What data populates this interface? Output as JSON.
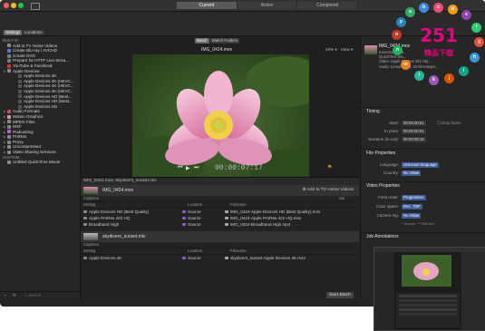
{
  "topbar": {
    "segments": [
      "Current",
      "Active",
      "Completed"
    ],
    "active_segment": 0
  },
  "sidebar": {
    "tabs": [
      "Settings",
      "Locations"
    ],
    "items": [
      {
        "label": "BUILT-IN",
        "type": "header"
      },
      {
        "label": "Add to TV Home Videos",
        "type": "item",
        "color": "#8a8a8a"
      },
      {
        "label": "Create Blu-ray / AVCHD",
        "type": "item",
        "color": "#4a7fd1"
      },
      {
        "label": "Create DVD",
        "type": "item",
        "color": "#7a7a7a"
      },
      {
        "label": "Prepare for HTTP Live Strea...",
        "type": "item",
        "color": "#7a7a7a"
      },
      {
        "label": "YouTube & Facebook",
        "type": "item",
        "color": "#d33"
      },
      {
        "label": "Apple Devices",
        "type": "group",
        "color": "#888"
      },
      {
        "label": "Apple Devices 4K",
        "type": "sub"
      },
      {
        "label": "Apple Devices 4K (HEVC...",
        "type": "sub"
      },
      {
        "label": "Apple Devices 4K (HEVC...",
        "type": "sub"
      },
      {
        "label": "Apple Devices 4K (HEVC...",
        "type": "sub"
      },
      {
        "label": "Apple Devices HD (Best...",
        "type": "sub"
      },
      {
        "label": "Apple Devices HD (Most...",
        "type": "sub"
      },
      {
        "label": "Apple Devices SD",
        "type": "sub"
      },
      {
        "label": "Audio Formats",
        "type": "group",
        "color": "#b55"
      },
      {
        "label": "Motion Graphics",
        "type": "group",
        "color": "#c9a"
      },
      {
        "label": "MPEG Files",
        "type": "group",
        "color": "#888"
      },
      {
        "label": "MXF",
        "type": "group",
        "color": "#888"
      },
      {
        "label": "Podcasting",
        "type": "group",
        "color": "#a6c"
      },
      {
        "label": "ProRes",
        "type": "group",
        "color": "#888"
      },
      {
        "label": "Proxy",
        "type": "group",
        "color": "#888"
      },
      {
        "label": "Uncompressed",
        "type": "group",
        "color": "#888"
      },
      {
        "label": "Video Sharing Services",
        "type": "group",
        "color": "#888"
      },
      {
        "label": "CUSTOM",
        "type": "header"
      },
      {
        "label": "Untitled QuickTime Movie",
        "type": "item",
        "color": "#888"
      }
    ],
    "search_placeholder": "Search"
  },
  "viewer": {
    "tabs": [
      "Batch",
      "Watch Folders"
    ],
    "filename": "IMG_0424.mov",
    "zoom": "23%",
    "view_label": "View",
    "timecode": "00:00:07:17"
  },
  "batch": {
    "job1_header": "IMG_0424.mov, skydivers_sunset.mlv",
    "job1_file": "IMG_0424.mov",
    "add_to_label": "Add to TV Home Videos",
    "columns": [
      "Captions",
      "Setting",
      "Location",
      "Filename"
    ],
    "set_label": "Set",
    "rows1": [
      {
        "setting": "Apple Devices HD (Best Quality)",
        "location": "Source",
        "filename": "IMG_0424-Apple Devices HD (Best Quality).m4v"
      },
      {
        "setting": "Apple ProRes 422 HQ",
        "location": "Source",
        "filename": "IMG_0424-Apple ProRes 422 HQ.mov"
      },
      {
        "setting": "Broadband High",
        "location": "Source",
        "filename": "IMG_0424-Broadband High.mp4"
      }
    ],
    "job2_file": "skydivers_sunset.mlv",
    "rows2": [
      {
        "setting": "Apple Devices 4K",
        "location": "Source",
        "filename": "skydivers_sunset-Apple Devices 4K.m4v"
      }
    ],
    "start_button": "Start Batch"
  },
  "inspector": {
    "file": "IMG_0424.mov",
    "summary": [
      "Kosmos/Kraus...",
      "QuickTime Mo...",
      "Video: Apple ProRes 422 HQ...",
      "Audio: Linear PCM, 24-bit Integer..."
    ],
    "timing_title": "Timing",
    "start_label": "Start:",
    "start_value": "00:00:00:01",
    "in_label": "In point:",
    "in_value": "00:00:00:01",
    "dur_label": "Duration (in-out):",
    "dur_value": "00:00:00:18",
    "drop_frame": "Drop frame",
    "file_props_title": "File Properties",
    "language_label": "Language:",
    "language_value": "Unknown language",
    "country_label": "Country:",
    "country_value": "No Value",
    "video_props_title": "Video Properties",
    "field_label": "Field order:",
    "field_value": "Progressive",
    "color_label": "Color space:",
    "color_value": "Rec. 709*",
    "camera_label": "Camera log:",
    "camera_value": "No Value",
    "source_note": "* Source, ** Inferred",
    "job_annotations": "Job Annotations"
  },
  "logo": {
    "text": "251",
    "subtext": "精品下载"
  }
}
